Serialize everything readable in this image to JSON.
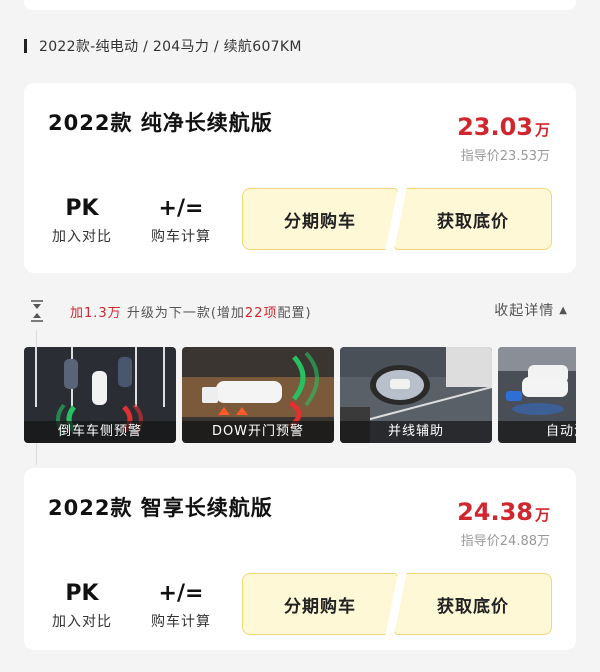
{
  "section": {
    "heading": "2022款-纯电动 / 204马力 / 续航607KM"
  },
  "cards": [
    {
      "title": "2022款 纯净长续航版",
      "price": "23.03",
      "price_unit": "万",
      "guide_price": "指导价23.53万",
      "pk_icon": "PK",
      "pk_label": "加入对比",
      "calc_icon": "+/=",
      "calc_label": "购车计算",
      "installment_label": "分期购车",
      "lowest_label": "获取底价"
    },
    {
      "title": "2022款 智享长续航版",
      "price": "24.38",
      "price_unit": "万",
      "guide_price": "指导价24.88万",
      "pk_icon": "PK",
      "pk_label": "加入对比",
      "calc_icon": "+/=",
      "calc_label": "购车计算",
      "installment_label": "分期购车",
      "lowest_label": "获取底价"
    }
  ],
  "upgrade": {
    "prefix": "加1.3万",
    "middle": " 升级为下一款(增加",
    "count": "22项",
    "suffix": "配置)",
    "collapse_label": "收起详情",
    "collapse_icon": "▲"
  },
  "features": [
    {
      "caption": "倒车车侧预警"
    },
    {
      "caption": "DOW开门预警"
    },
    {
      "caption": "并线辅助"
    },
    {
      "caption": "自动泊车"
    }
  ],
  "colors": {
    "price_red": "#d0262e",
    "button_bg": "#fff8d7",
    "button_border": "#f0d77a"
  }
}
